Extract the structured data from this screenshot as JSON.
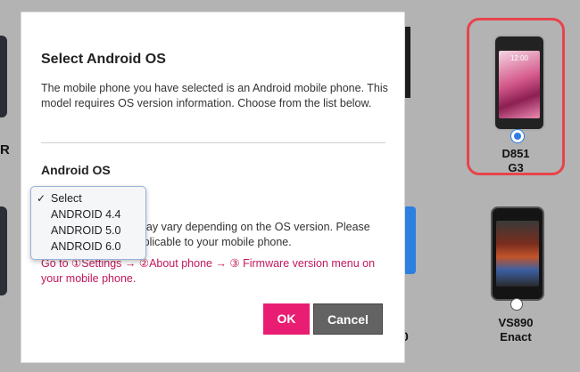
{
  "background": {
    "left_letter": "R",
    "digit": "0",
    "phones": [
      {
        "model": "D851",
        "name": "G3",
        "time": "12:00",
        "selected": true
      },
      {
        "model": "VS890",
        "name": "Enact",
        "selected": false
      }
    ]
  },
  "modal": {
    "title": "Select Android OS",
    "description": "The mobile phone you have selected is an Android mobile phone. This model requires OS version information. Choose from the list below.",
    "section_label": "Android OS",
    "note_text": "Available functions may vary depending on the OS version. Please select the version applicable to your mobile phone.",
    "note_link": "Go to ①Settings → ②About phone → ③ Firmware version menu on your mobile phone.",
    "ok_label": "OK",
    "cancel_label": "Cancel"
  },
  "dropdown": {
    "selected_mark": "✓",
    "options": [
      "Select",
      "ANDROID 4.4",
      "ANDROID 5.0",
      "ANDROID 6.0"
    ]
  },
  "colors": {
    "accent": "#e91e73",
    "highlight_border": "#e8434a",
    "radio_selected": "#2f7de1",
    "link": "#c2185b"
  }
}
